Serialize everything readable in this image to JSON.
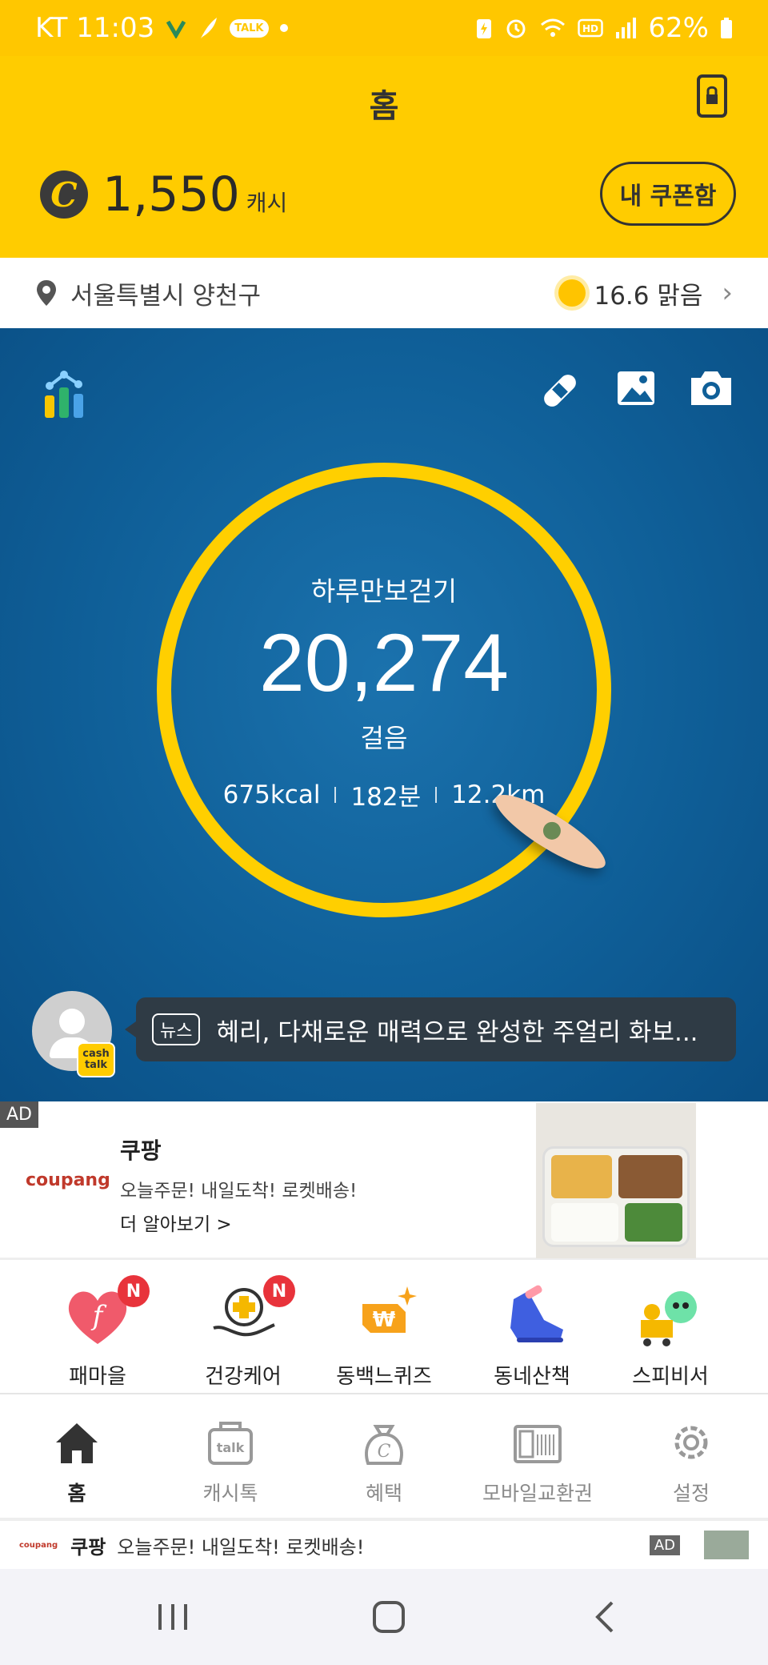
{
  "status_bar": {
    "carrier_time": "KT 11:03",
    "talk_label": "TALK",
    "battery": "62%"
  },
  "header": {
    "title": "홈",
    "cash_symbol": "C",
    "cash_amount": "1,550",
    "cash_unit": "캐시",
    "coupon_button": "내 쿠폰함"
  },
  "location": {
    "address": "서울특별시 양천구",
    "weather": "16.6 맑음"
  },
  "steps": {
    "label": "하루만보걷기",
    "count": "20,274",
    "unit": "걸음",
    "calories": "675kcal",
    "minutes": "182분",
    "distance": "12.2km"
  },
  "news": {
    "badge_text": "cash talk",
    "tag": "뉴스",
    "headline": "혜리, 다채로운 매력으로 완성한 주얼리 화보..."
  },
  "ad": {
    "tag": "AD",
    "brand_logo": "coupang",
    "title": "쿠팡",
    "description": "오늘주문! 내일도착! 로켓배송!",
    "more": "더 알아보기 >"
  },
  "shortcuts": [
    {
      "label": "패마을",
      "badge": "N",
      "icon": "heart-f-icon"
    },
    {
      "label": "건강케어",
      "badge": "N",
      "icon": "health-care-icon"
    },
    {
      "label": "동백느퀴즈",
      "badge": "",
      "icon": "quiz-icon"
    },
    {
      "label": "동네산책",
      "badge": "",
      "icon": "sneaker-icon"
    },
    {
      "label": "스피비서",
      "badge": "",
      "icon": "shopping-character-icon"
    }
  ],
  "bottom_nav": [
    {
      "label": "홈",
      "active": true,
      "icon": "home-icon"
    },
    {
      "label": "캐시톡",
      "active": false,
      "icon": "talk-bag-icon"
    },
    {
      "label": "혜택",
      "active": false,
      "icon": "coin-bag-icon"
    },
    {
      "label": "모바일교환권",
      "active": false,
      "icon": "voucher-icon"
    },
    {
      "label": "설정",
      "active": false,
      "icon": "gear-icon"
    }
  ],
  "banner": {
    "logo": "coupang",
    "title": "쿠팡",
    "text": "오늘주문! 내일도착! 로켓배송!",
    "ad": "AD"
  },
  "colors": {
    "brand_yellow": "#ffcc00",
    "hero_blue": "#0f5f98",
    "ring_yellow": "#ffcf00",
    "badge_red": "#e8333b"
  }
}
